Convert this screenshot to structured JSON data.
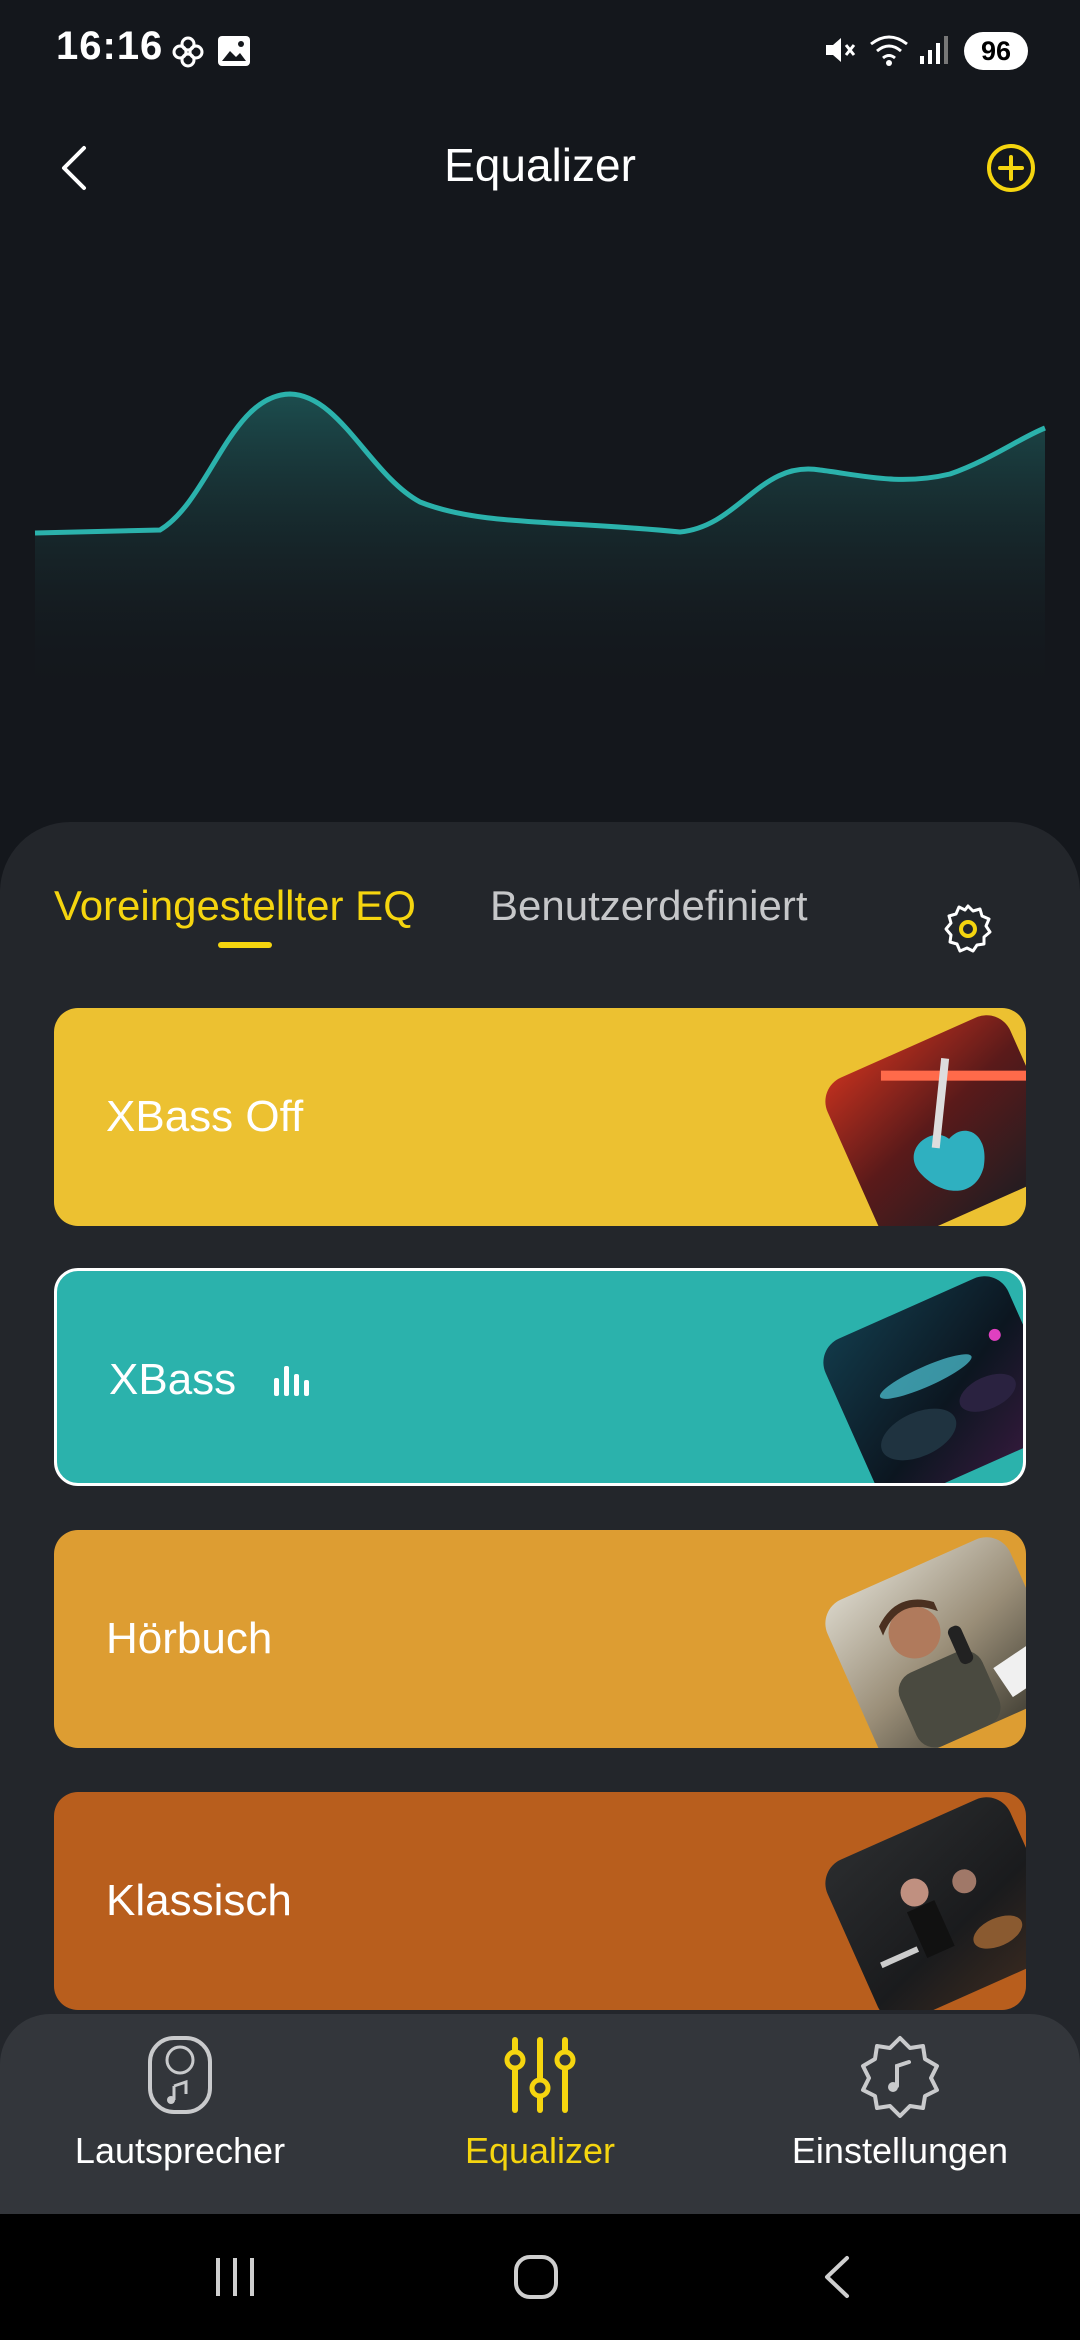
{
  "status_bar": {
    "time": "16:16",
    "battery": "96",
    "icons": [
      "flower-icon",
      "image-icon",
      "mute-icon",
      "wifi-icon",
      "signal-icon"
    ]
  },
  "header": {
    "title": "Equalizer",
    "back_icon": "chevron-left-icon",
    "add_icon": "plus-circle-icon"
  },
  "colors": {
    "background": "#14171c",
    "panel": "#23262b",
    "accent": "#f5d50f",
    "graph_line": "#2bb2ac",
    "nav_bar": "#33363b"
  },
  "tabs": {
    "preset": "Voreingestellter EQ",
    "custom": "Benutzerdefiniert",
    "active": "preset"
  },
  "presets": [
    {
      "label": "XBass Off",
      "color": "#ecc131",
      "selected": false
    },
    {
      "label": "XBass",
      "color": "#2bb2ac",
      "selected": true,
      "playing_icon": "equalizer-bars-icon"
    },
    {
      "label": "Hörbuch",
      "color": "#dd9d32",
      "selected": false
    },
    {
      "label": "Klassisch",
      "color": "#b85e1d",
      "selected": false
    }
  ],
  "bottom_nav": {
    "items": [
      {
        "label": "Lautsprecher",
        "icon": "speaker-icon",
        "active": false
      },
      {
        "label": "Equalizer",
        "icon": "sliders-icon",
        "active": true
      },
      {
        "label": "Einstellungen",
        "icon": "settings-note-icon",
        "active": false
      }
    ]
  },
  "system_nav": [
    "recents-icon",
    "home-icon",
    "back-icon"
  ]
}
